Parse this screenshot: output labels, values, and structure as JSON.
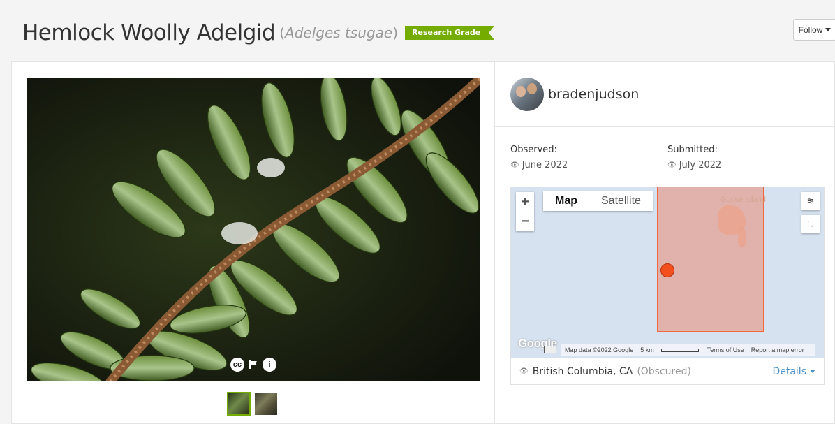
{
  "header": {
    "common_name": "Hemlock Woolly Adelgid",
    "scientific_name": "Adelges tsugae",
    "quality_grade": "Research Grade",
    "follow_label": "Follow"
  },
  "photo": {
    "controls": {
      "license_icon": "cc",
      "flag_icon": "flag",
      "info_icon": "i"
    },
    "thumbnails": [
      "thumbnail-1",
      "thumbnail-2"
    ]
  },
  "observer": {
    "username": "bradenjudson"
  },
  "observed": {
    "label": "Observed:",
    "value": "June 2022"
  },
  "submitted": {
    "label": "Submitted:",
    "value": "July 2022"
  },
  "map": {
    "type_map": "Map",
    "type_satellite": "Satellite",
    "zoom_in": "+",
    "zoom_out": "−",
    "place_label": "Goose Island",
    "logo": "Google",
    "attribution": "Map data ©2022 Google",
    "scale": "5 km",
    "terms": "Terms of Use",
    "report": "Report a map error"
  },
  "location": {
    "place": "British Columbia, CA",
    "status": "(Obscured)",
    "details_label": "Details"
  },
  "colors": {
    "research_grade": "#74ac00",
    "link": "#4a90c9",
    "obscured_area": "#ef6a42",
    "pin": "#f24e1e"
  }
}
